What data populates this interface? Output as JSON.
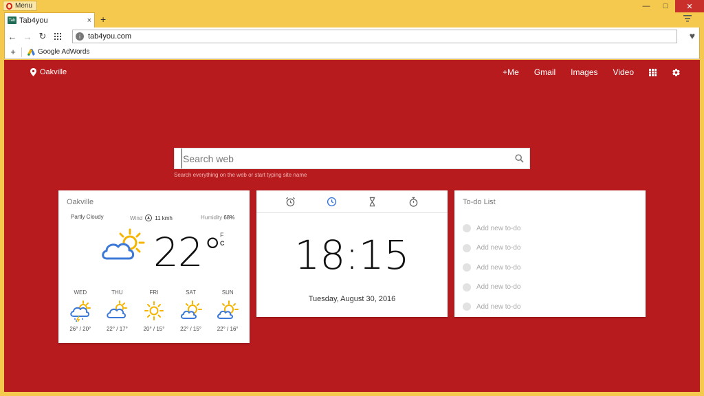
{
  "browser": {
    "menu_label": "Menu",
    "tab_title": "Tab4you",
    "tab_favicon_text": "Tab",
    "url": "tab4you.com",
    "bookmark_label": "Google AdWords"
  },
  "header": {
    "location": "Oakville",
    "nav": [
      "+Me",
      "Gmail",
      "Images",
      "Video"
    ]
  },
  "search": {
    "placeholder": "Search web",
    "hint": "Search everything on the web or start typing site name"
  },
  "weather": {
    "city": "Oakville",
    "condition": "Partly Cloudy",
    "wind_label": "Wind",
    "wind_value": "11 kmh",
    "humidity_label": "Humidity",
    "humidity_value": "68%",
    "temp": "22°",
    "unit_f": "F",
    "unit_c": "C",
    "forecast": [
      {
        "day": "WED",
        "temps": "26° / 20°",
        "icon": "storm-icon"
      },
      {
        "day": "THU",
        "temps": "22° / 17°",
        "icon": "partly-cloudy-icon"
      },
      {
        "day": "FRI",
        "temps": "20° / 15°",
        "icon": "sun-icon"
      },
      {
        "day": "SAT",
        "temps": "22° / 15°",
        "icon": "sun-cloud-icon"
      },
      {
        "day": "SUN",
        "temps": "22° / 16°",
        "icon": "sun-cloud-icon"
      }
    ]
  },
  "clock": {
    "time": "18:15",
    "date": "Tuesday, August 30, 2016",
    "tabs": [
      "alarm-icon",
      "clock-icon",
      "hourglass-icon",
      "stopwatch-icon"
    ],
    "active_tab": "clock-icon"
  },
  "todo": {
    "title": "To-do List",
    "items": [
      "Add new to-do",
      "Add new to-do",
      "Add new to-do",
      "Add new to-do",
      "Add new to-do"
    ]
  },
  "colors": {
    "page_bg": "#b81b1e",
    "frame": "#f5c84e",
    "accent_blue": "#3c78d8",
    "sun_yellow": "#f4b400"
  }
}
